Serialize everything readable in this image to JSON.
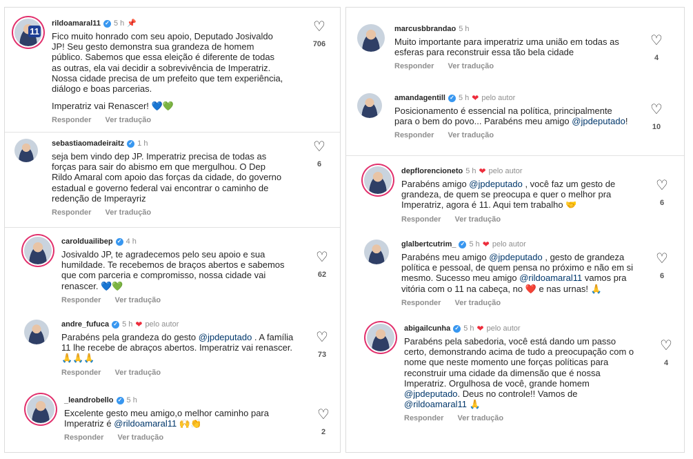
{
  "ui": {
    "reply_label": "Responder",
    "translate_label": "Ver tradução",
    "author_tag": "pelo autor"
  },
  "left": [
    {
      "username": "rildoamaral11",
      "time": "5 h",
      "pinned": true,
      "text": "Fico muito honrado com seu apoio, Deputado Josivaldo\nJP! Seu gesto demonstra sua grandeza de homem\npúblico. Sabemos que essa eleição é diferente de todas\nas outras, ela vai decidir a sobrevivência de Imperatriz.\nNossa cidade precisa de um prefeito que tem experiência,\ndiálogo e boas parcerias.",
      "text2": "Imperatriz vai Renascer! 💙💚",
      "likes": "706"
    },
    {
      "username": "sebastiaomadeiraitz",
      "time": "1 h",
      "text": "seja bem vindo dep JP. Imperatriz precisa de todas as\nforças para sair do abismo em que mergulhou. O Dep\nRildo Amaral com apoio das forças da cidade, do governo\nestadual e governo federal vai encontrar o caminho de\nredenção de Imperayriz",
      "likes": "6"
    },
    {
      "username": "carolduailibep",
      "time": "4 h",
      "text": "Josivaldo JP, te agradecemos pelo seu apoio e sua\nhumildade. Te recebemos de braços abertos e sabemos\nque com parceria e compromisso, nossa cidade vai\nrenascer. 💙💚",
      "likes": "62"
    },
    {
      "username": "andre_fufuca",
      "time": "5 h",
      "by_author": true,
      "text_pre": "Parabéns pela grandeza do gesto ",
      "mention": "@jpdeputado",
      "text_post": " . A família\n11 lhe recebe de abraços abertos. Imperatriz vai renascer.\n🙏🙏🙏",
      "likes": "73"
    },
    {
      "username": "_leandrobello",
      "time": "5 h",
      "text_pre": "Excelente gesto meu amigo,o melhor caminho para\nImperatriz é ",
      "mention": "@rildoamaral11",
      "text_post": " 🙌👏",
      "likes": "2"
    }
  ],
  "right": [
    {
      "username": "marcusbbrandao",
      "time": "5 h",
      "text": "Muito importante para imperatriz uma união em todas as\nesferas para reconstruir essa tão bela cidade",
      "likes": "4"
    },
    {
      "username": "amandagentill",
      "time": "5 h",
      "by_author": true,
      "text_pre": "Posicionamento é essencial na política, principalmente\npara o bem do povo... Parabéns meu amigo ",
      "mention": "@jpdeputado",
      "text_post": "!",
      "likes": "10"
    },
    {
      "username": "depflorencioneto",
      "time": "5 h",
      "by_author": true,
      "text_pre": "Parabéns amigo ",
      "mention": "@jpdeputado",
      "text_post": " , você faz um gesto de\ngrandeza, de quem se preocupa e quer o melhor pra\nImperatriz, agora é 11. Aqui tem trabalho 🤝",
      "likes": "6"
    },
    {
      "username": "glalbertcutrim_",
      "time": "5 h",
      "by_author": true,
      "text_pre": "Parabéns meu amigo ",
      "mention": "@jpdeputado",
      "text_mid": " , gesto de grandeza\npolítica e pessoal, de quem pensa no próximo e não em si\nmesmo. Sucesso meu amigo ",
      "mention2": "@rildoamaral11",
      "text_post": " vamos pra\nvitória com o 11 na cabeça, no ❤️ e nas urnas! 🙏",
      "likes": "6"
    },
    {
      "username": "abigailcunha",
      "time": "5 h",
      "by_author": true,
      "text_pre": "Parabéns pela sabedoria, você está dando um passo\ncerto, demonstrando acima de tudo a preocupação com o\nnome que neste momento une forças políticas para\nreconstruir uma cidade da dimensão que é nossa\nImperatriz. Orgulhosa de você, grande homem\n",
      "mention": "@jpdeputado",
      "text_mid": ". Deus no controle!! Vamos de\n",
      "mention2": "@rildoamaral11",
      "text_post": " 🙏",
      "likes": "4"
    }
  ]
}
